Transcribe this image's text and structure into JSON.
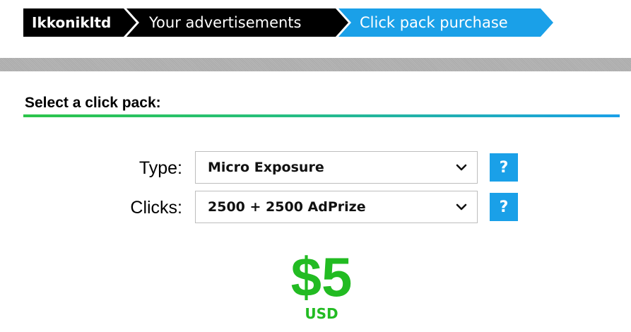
{
  "breadcrumb": {
    "items": [
      {
        "label": "Ikkonikltd"
      },
      {
        "label": "Your advertisements"
      },
      {
        "label": "Click pack purchase"
      }
    ],
    "active_color": "#1aa0e8",
    "inactive_color": "#000000"
  },
  "section": {
    "title": "Select a click pack:"
  },
  "form": {
    "type": {
      "label": "Type:",
      "selected": "Micro Exposure",
      "help": "?"
    },
    "clicks": {
      "label": "Clicks:",
      "selected": "2500 + 2500 AdPrize",
      "help": "?"
    }
  },
  "price": {
    "amount": "$5",
    "currency": "USD",
    "color": "#22bb22"
  }
}
